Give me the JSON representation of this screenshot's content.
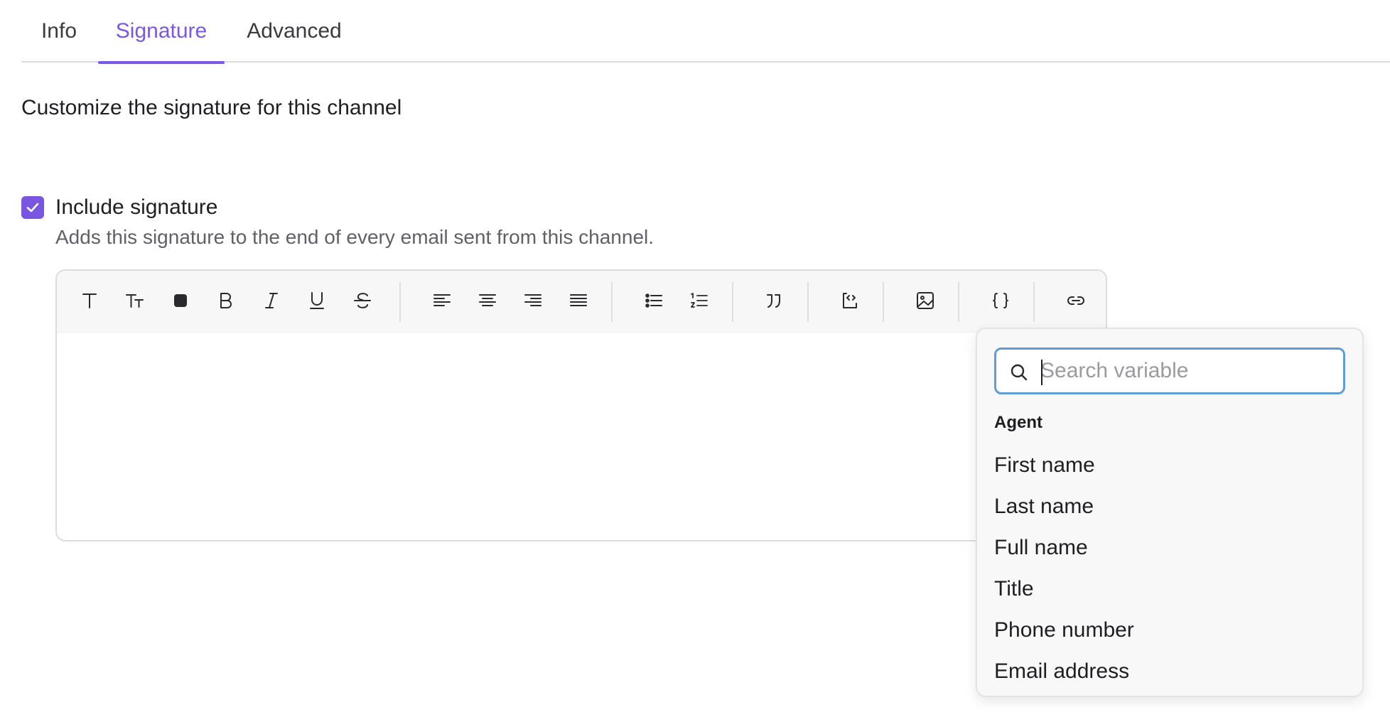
{
  "tabs": [
    {
      "label": "Info"
    },
    {
      "label": "Signature"
    },
    {
      "label": "Advanced"
    }
  ],
  "active_tab": "Signature",
  "page": {
    "subtitle": "Customize the signature for this channel"
  },
  "include_signature": {
    "checked": true,
    "label": "Include signature",
    "help": "Adds this signature to the end of every email sent from this channel."
  },
  "toolbar": {
    "buttons": [
      "text-style-icon",
      "font-size-icon",
      "text-color-icon",
      "bold-icon",
      "italic-icon",
      "underline-icon",
      "strikethrough-icon",
      "align-left-icon",
      "align-center-icon",
      "align-right-icon",
      "align-justify-icon",
      "bullet-list-icon",
      "numbered-list-icon",
      "quote-icon",
      "code-block-icon",
      "image-icon",
      "variable-icon",
      "link-icon"
    ]
  },
  "variables_dropdown": {
    "search_placeholder": "Search variable",
    "search_value": "",
    "group_label": "Agent",
    "options": [
      {
        "label": "First name"
      },
      {
        "label": "Last name"
      },
      {
        "label": "Full name"
      },
      {
        "label": "Title"
      },
      {
        "label": "Phone number"
      },
      {
        "label": "Email address"
      }
    ]
  },
  "colors": {
    "accent": "#7b57e6",
    "focus_ring": "#5d9ed6"
  }
}
